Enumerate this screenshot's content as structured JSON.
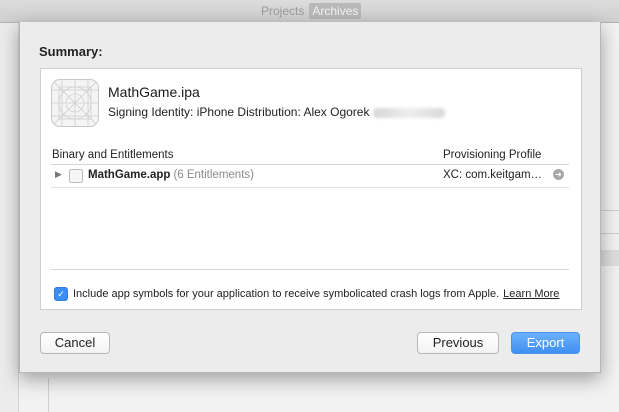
{
  "window": {
    "tabs": [
      "Projects",
      "Archives"
    ],
    "active_tab": "Archives"
  },
  "sheet": {
    "title": "Summary:",
    "ipa_name": "MathGame.ipa",
    "signing_label": "Signing Identity: iPhone Distribution: Alex Ogorek",
    "columns": {
      "left": "Binary and Entitlements",
      "right": "Provisioning Profile"
    },
    "rows": [
      {
        "name": "MathGame.app",
        "entitlements": "(6 Entitlements)",
        "profile": "XC: com.keitgam…"
      }
    ],
    "symbols_text": "Include app symbols for your application to receive symbolicated crash logs from Apple.",
    "symbols_checked": true,
    "learn_more": "Learn More",
    "buttons": {
      "cancel": "Cancel",
      "previous": "Previous",
      "export": "Export"
    }
  },
  "colors": {
    "accent": "#3f8ff2",
    "checkbox": "#3b8ff4"
  }
}
